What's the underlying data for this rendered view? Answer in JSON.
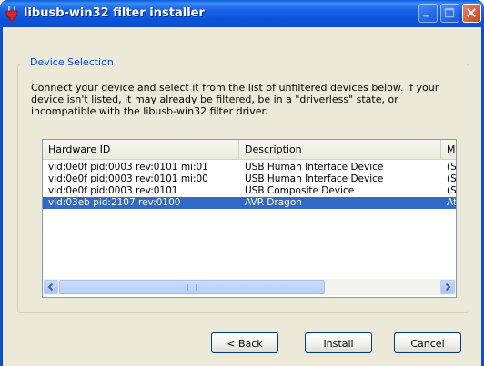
{
  "window": {
    "title": "libusb-win32 filter installer"
  },
  "group": {
    "label": "Device Selection",
    "intro": "Connect your device and select it from the list of unfiltered devices below. If your device isn't listed, it may already be filtered, be in a \"driverless\" state, or incompatible with the libusb-win32 filter driver."
  },
  "device_list": {
    "columns": [
      "Hardware ID",
      "Description",
      "M"
    ],
    "rows": [
      {
        "hardware_id": "vid:0e0f pid:0003 rev:0101 mi:01",
        "description": "USB Human Interface Device",
        "m": "(St"
      },
      {
        "hardware_id": "vid:0e0f pid:0003 rev:0101 mi:00",
        "description": "USB Human Interface Device",
        "m": "(St"
      },
      {
        "hardware_id": "vid:0e0f pid:0003 rev:0101",
        "description": "USB Composite Device",
        "m": "(St"
      },
      {
        "hardware_id": "vid:03eb pid:2107 rev:0100",
        "description": "AVR Dragon",
        "m": "At"
      }
    ],
    "selected_index": 3
  },
  "buttons": {
    "back": "< Back",
    "install": "Install",
    "cancel": "Cancel"
  },
  "colors": {
    "titlebar": "#0c4fcc",
    "selection": "#316ac5",
    "group_label": "#0046d5",
    "dialog_bg": "#ece9d8"
  },
  "icons": {
    "app": "usb-plug-icon",
    "minimize": "minimize-icon",
    "maximize": "maximize-icon",
    "close": "close-icon"
  }
}
